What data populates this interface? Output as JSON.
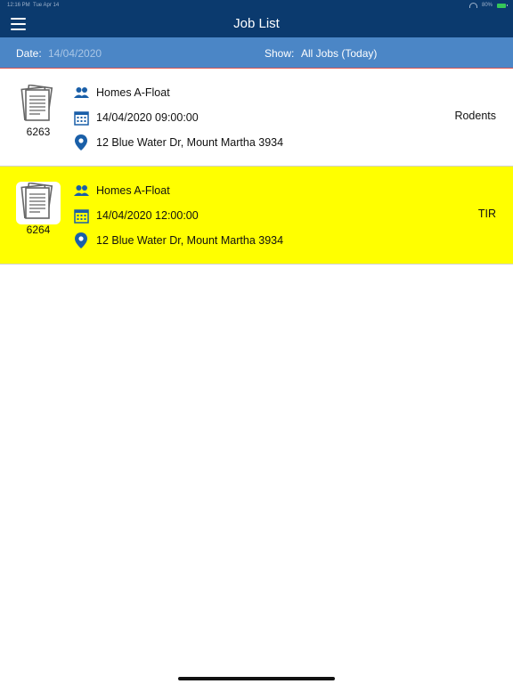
{
  "status_bar": {
    "time": "12:16 PM",
    "date": "Tue Apr 14",
    "battery": "80%"
  },
  "nav": {
    "title": "Job List"
  },
  "filter": {
    "date_label": "Date:",
    "date_value": "14/04/2020",
    "show_label": "Show:",
    "show_value": "All Jobs (Today)"
  },
  "jobs": [
    {
      "number": "6263",
      "client": "Homes A-Float",
      "datetime": "14/04/2020 09:00:00",
      "address": "12 Blue Water Dr, Mount Martha 3934",
      "type": "Rodents",
      "highlighted": false
    },
    {
      "number": "6264",
      "client": "Homes A-Float",
      "datetime": "14/04/2020 12:00:00",
      "address": "12 Blue Water Dr, Mount Martha 3934",
      "type": "TIR",
      "highlighted": true
    }
  ],
  "icons": {
    "menu": "hamburger-icon",
    "client": "people-icon",
    "date": "calendar-icon",
    "address": "location-pin-icon",
    "document": "documents-icon"
  },
  "colors": {
    "nav_bg": "#0b3a6e",
    "filter_bg": "#4b86c6",
    "highlight": "#ffff00",
    "icon_blue": "#1a5fa8"
  }
}
